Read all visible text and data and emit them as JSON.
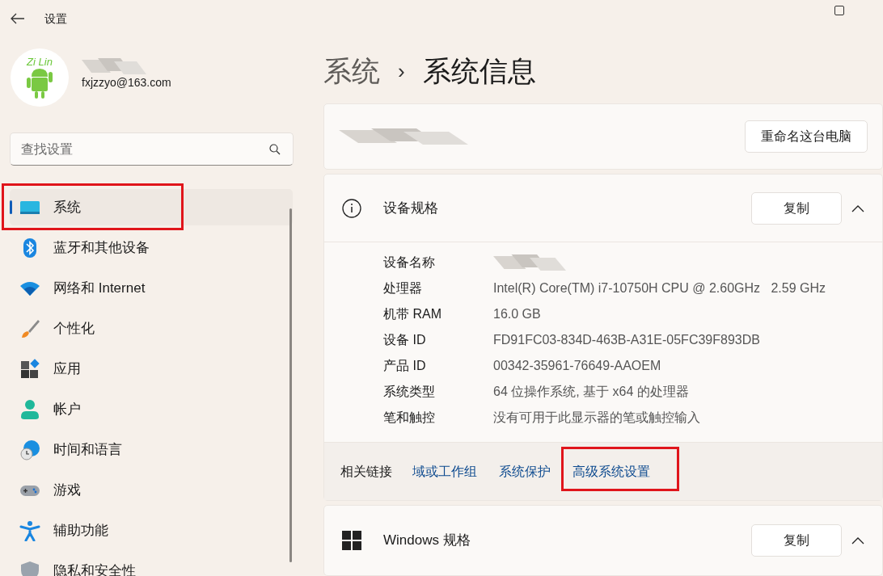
{
  "window": {
    "title": "设置"
  },
  "account": {
    "email": "fxjzzyo@163.com",
    "avatar_text": "Zi Lin"
  },
  "search": {
    "placeholder": "查找设置"
  },
  "sidebar": {
    "items": [
      {
        "label": "系统",
        "kind": "system",
        "selected": true,
        "highlighted": true
      },
      {
        "label": "蓝牙和其他设备",
        "kind": "bluetooth",
        "selected": false,
        "highlighted": false
      },
      {
        "label": "网络和 Internet",
        "kind": "wifi",
        "selected": false,
        "highlighted": false
      },
      {
        "label": "个性化",
        "kind": "brush",
        "selected": false,
        "highlighted": false
      },
      {
        "label": "应用",
        "kind": "apps",
        "selected": false,
        "highlighted": false
      },
      {
        "label": "帐户",
        "kind": "person",
        "selected": false,
        "highlighted": false
      },
      {
        "label": "时间和语言",
        "kind": "globe",
        "selected": false,
        "highlighted": false
      },
      {
        "label": "游戏",
        "kind": "gamepad",
        "selected": false,
        "highlighted": false
      },
      {
        "label": "辅助功能",
        "kind": "accessibility",
        "selected": false,
        "highlighted": false
      },
      {
        "label": "隐私和安全性",
        "kind": "shield",
        "selected": false,
        "highlighted": false
      }
    ]
  },
  "breadcrumb": {
    "parent": "系统",
    "separator": "›",
    "current": "系统信息"
  },
  "device_card": {
    "rename_button": "重命名这台电脑"
  },
  "device_specs": {
    "title": "设备规格",
    "copy_button": "复制",
    "expanded": true,
    "rows": [
      {
        "label": "设备名称"
      },
      {
        "label": "处理器",
        "value": "Intel(R) Core(TM) i7-10750H CPU @ 2.60GHz   2.59 GHz"
      },
      {
        "label": "机带 RAM",
        "value": "16.0 GB"
      },
      {
        "label": "设备 ID",
        "value": "FD91FC03-834D-463B-A31E-05FC39F893DB"
      },
      {
        "label": "产品 ID",
        "value": "00342-35961-76649-AAOEM"
      },
      {
        "label": "系统类型",
        "value": "64 位操作系统, 基于 x64 的处理器"
      },
      {
        "label": "笔和触控",
        "value": "没有可用于此显示器的笔或触控输入"
      }
    ]
  },
  "related_links": {
    "label": "相关链接",
    "links": [
      {
        "text": "域或工作组",
        "highlighted": false
      },
      {
        "text": "系统保护",
        "highlighted": false
      },
      {
        "text": "高级系统设置",
        "highlighted": true
      }
    ]
  },
  "windows_specs": {
    "title": "Windows 规格",
    "copy_button": "复制",
    "expanded": true
  }
}
